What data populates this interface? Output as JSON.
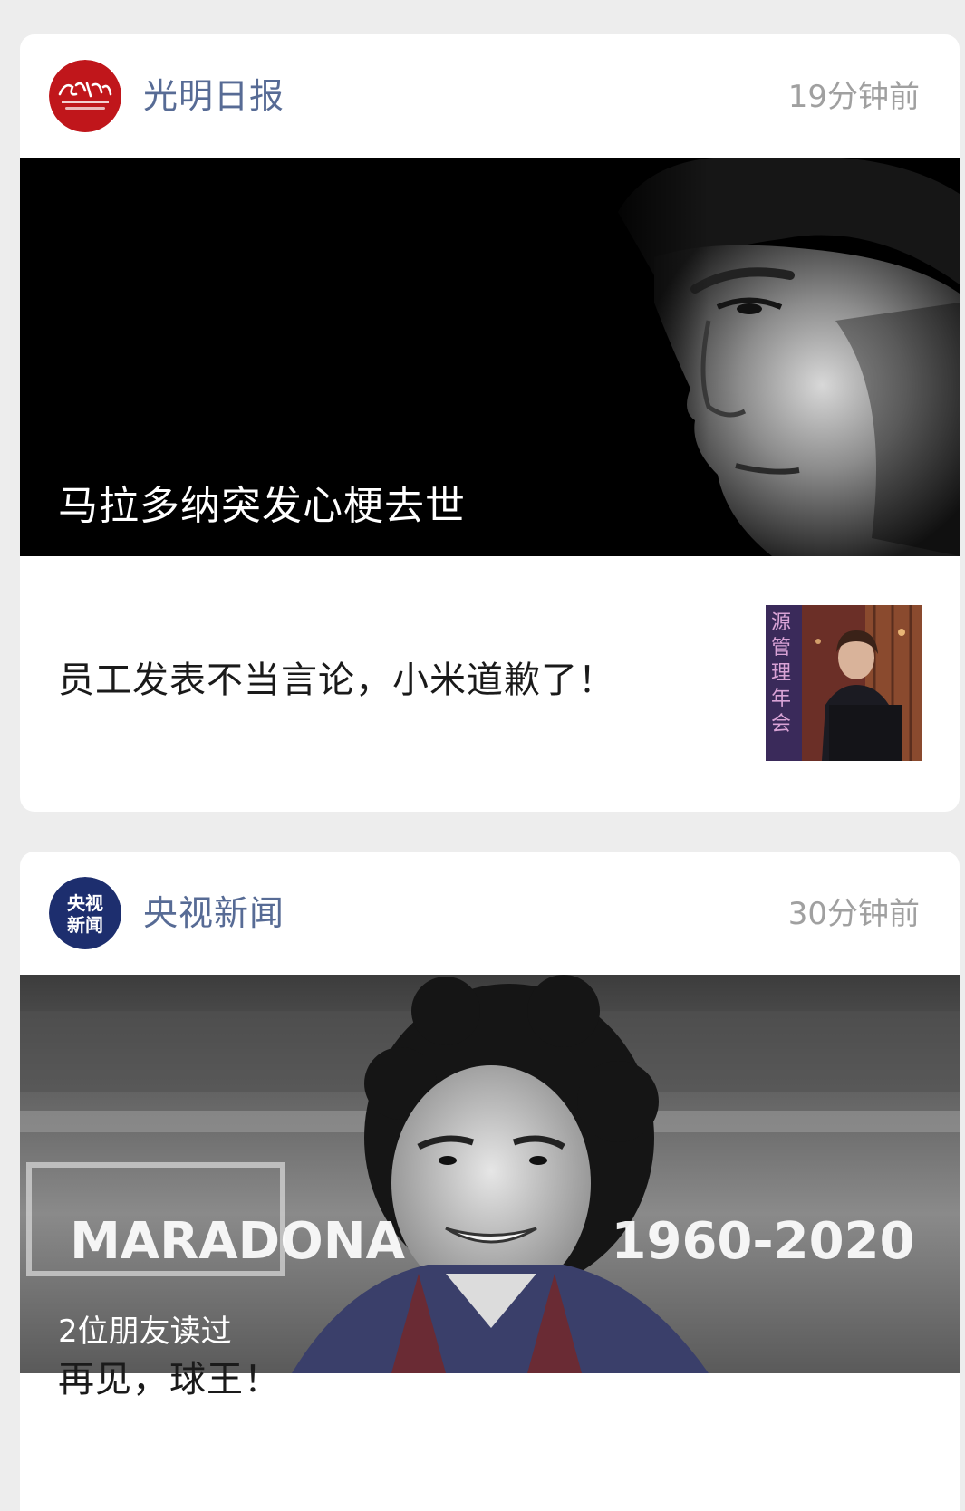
{
  "feed": {
    "cards": [
      {
        "source": "光明日报",
        "avatar_icon": "guangming-daily-logo",
        "avatar_color": "#c0161b",
        "time": "19分钟前",
        "hero_caption": "马拉多纳突发心梗去世",
        "row_title": "员工发表不当言论，小米道歉了！",
        "thumb_lines": [
          "源",
          "管",
          "理",
          "年",
          "会"
        ]
      },
      {
        "source": "央视新闻",
        "avatar_icon": "cctv-news-logo",
        "avatar_color": "#1d2e6e",
        "time": "30分钟前",
        "hero_name": "MARADONA",
        "hero_years": "1960-2020",
        "friends_read": "2位朋友读过",
        "title": "再见，球王！"
      }
    ]
  },
  "colors": {
    "source_name": "#576b95",
    "timestamp": "#a0a0a0",
    "background": "#ededed"
  }
}
